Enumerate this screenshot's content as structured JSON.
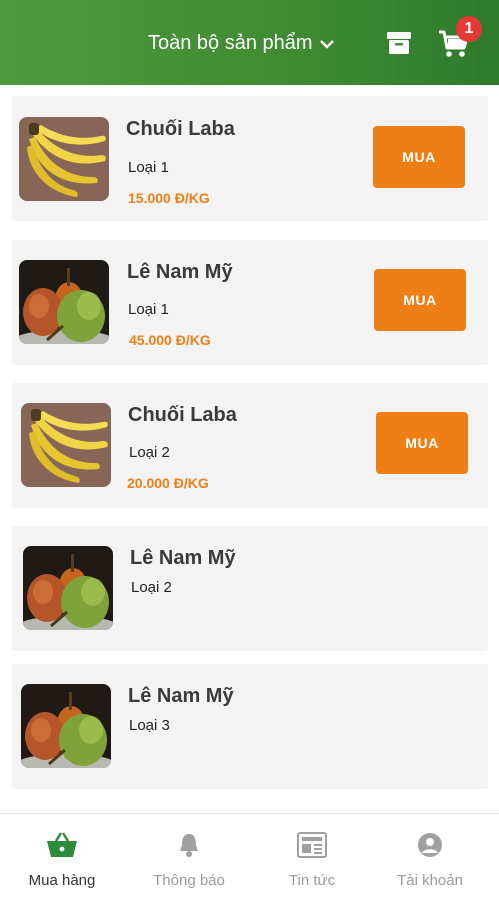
{
  "header": {
    "title": "Toàn bộ sản phẩm",
    "cart_count": "1"
  },
  "colors": {
    "header_green": "#3f8a33",
    "accent_orange": "#ee7f16",
    "badge_red": "#e53935",
    "card_bg": "#f3f3f3"
  },
  "products": [
    {
      "name": "Chuối Laba",
      "type": "Loại 1",
      "price": "15.000 Đ/KG",
      "button": "MUA",
      "image": "banana"
    },
    {
      "name": "Lê Nam Mỹ",
      "type": "Loại 1",
      "price": "45.000 Đ/KG",
      "button": "MUA",
      "image": "pear"
    },
    {
      "name": "Chuối Laba",
      "type": "Loại 2",
      "price": "20.000 Đ/KG",
      "button": "MUA",
      "image": "banana"
    },
    {
      "name": "Lê Nam Mỹ",
      "type": "Loại 2",
      "image": "pear"
    },
    {
      "name": "Lê Nam Mỹ",
      "type": "Loại 3",
      "image": "pear"
    }
  ],
  "bottom_nav": [
    {
      "label": "Mua hàng",
      "icon": "basket-icon",
      "active": true
    },
    {
      "label": "Thông báo",
      "icon": "bell-icon",
      "active": false
    },
    {
      "label": "Tin tức",
      "icon": "newspaper-icon",
      "active": false
    },
    {
      "label": "Tài khoản",
      "icon": "account-icon",
      "active": false
    }
  ]
}
